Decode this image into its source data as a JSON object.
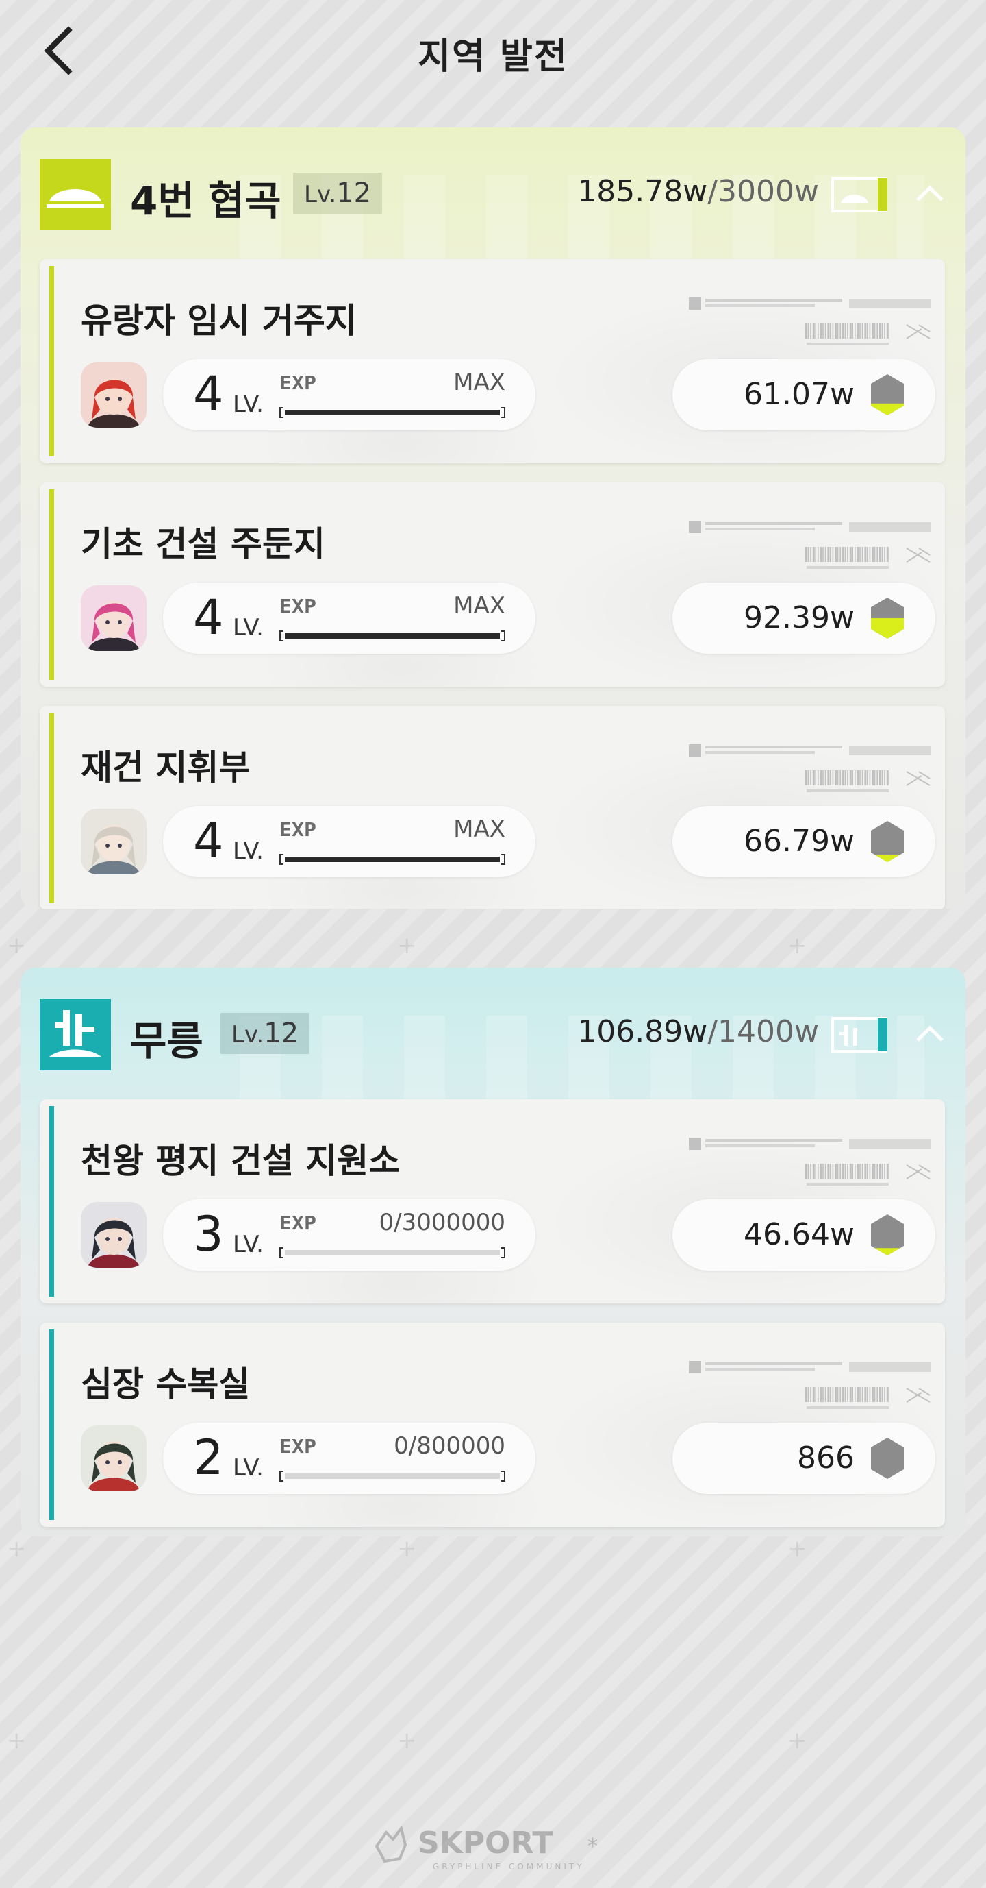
{
  "header": {
    "title": "지역 발전"
  },
  "regions": [
    {
      "name": "4번 협곡",
      "level_prefix": "Lv.",
      "level": "12",
      "income_current": "185.78w",
      "income_max": "/3000w",
      "accent_color": "#c6d81c",
      "logo_icon": "valley-dome-icon",
      "facilities": [
        {
          "name": "유랑자 임시 거주지",
          "level": "4",
          "level_label": "LV.",
          "exp_text": "MAX",
          "exp_progress": 1.0,
          "income": "61.07w",
          "hex_fill": 0.3,
          "avatar": "red-hair-character"
        },
        {
          "name": "기초 건설 주둔지",
          "level": "4",
          "level_label": "LV.",
          "exp_text": "MAX",
          "exp_progress": 1.0,
          "income": "92.39w",
          "hex_fill": 0.5,
          "avatar": "pink-hair-character"
        },
        {
          "name": "재건 지휘부",
          "level": "4",
          "level_label": "LV.",
          "exp_text": "MAX",
          "exp_progress": 1.0,
          "income": "66.79w",
          "hex_fill": 0.2,
          "avatar": "silver-hair-character"
        }
      ]
    },
    {
      "name": "무릉",
      "level_prefix": "Lv.",
      "level": "12",
      "income_current": "106.89w",
      "income_max": "/1400w",
      "accent_color": "#1aaeb0",
      "logo_icon": "wuling-city-icon",
      "facilities": [
        {
          "name": "천왕 평지 건설 지원소",
          "level": "3",
          "level_label": "LV.",
          "exp_text": "0/3000000",
          "exp_progress": 0.0,
          "income": "46.64w",
          "hex_fill": 0.2,
          "avatar": "dark-hair-character"
        },
        {
          "name": "심장 수복실",
          "level": "2",
          "level_label": "LV.",
          "exp_text": "0/800000",
          "exp_progress": 0.0,
          "income": "866",
          "hex_fill": 0.0,
          "avatar": "green-hair-character"
        }
      ]
    }
  ],
  "footer": {
    "brand": "SKPORT",
    "tagline": "GRYPHLINE COMMUNITY"
  }
}
